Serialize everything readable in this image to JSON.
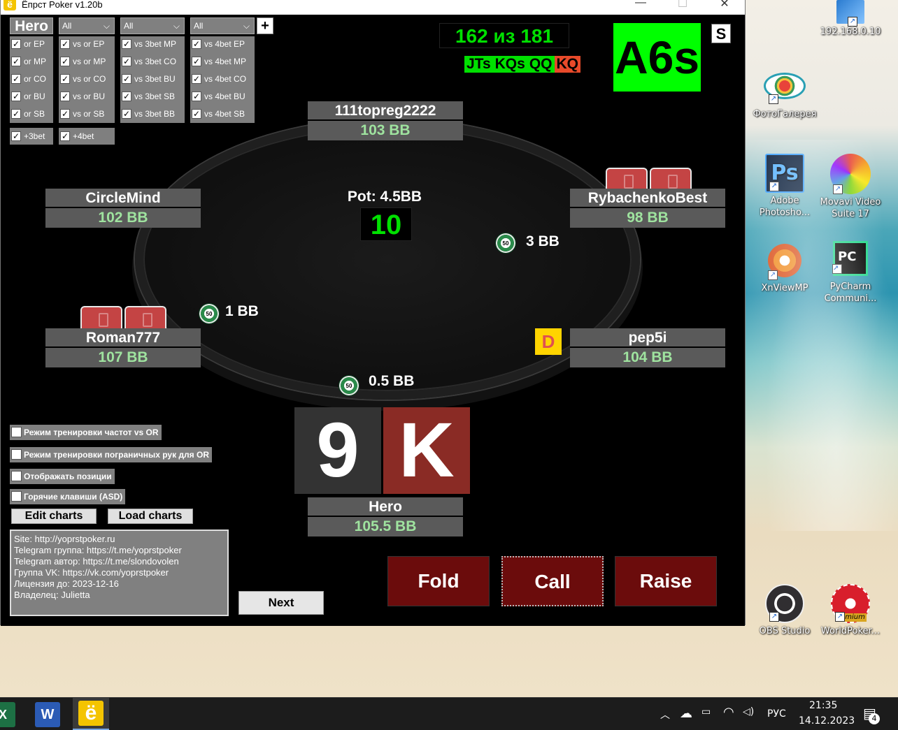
{
  "window": {
    "title": "Ёпрст Poker v1.20b",
    "app_icon": "ё"
  },
  "filters": {
    "hero_label": "Hero",
    "dropdowns": [
      "All",
      "All",
      "All"
    ],
    "plus": "+",
    "col1": [
      "or EP",
      "or MP",
      "or CO",
      "or BU",
      "or SB"
    ],
    "col2": [
      "vs or EP",
      "vs or MP",
      "vs or CO",
      "vs or BU",
      "vs or SB"
    ],
    "col3": [
      "vs 3bet MP",
      "vs 3bet CO",
      "vs 3bet BU",
      "vs 3bet SB",
      "vs 3bet BB"
    ],
    "col4": [
      "vs 4bet EP",
      "vs 4bet MP",
      "vs 4bet CO",
      "vs 4bet BU",
      "vs 4bet SB"
    ],
    "extra": [
      "+3bet",
      "+4bet"
    ]
  },
  "counter": "162 из 181",
  "hands_strip": {
    "green": [
      "JTs",
      "KQs",
      "QQ"
    ],
    "red": "KQ"
  },
  "big_hand": "A6s",
  "s_button": "S",
  "pot": {
    "label": "Pot: 4.5BB",
    "timer": "10"
  },
  "players": [
    {
      "name": "111topreg2222",
      "stack": "103 BB"
    },
    {
      "name": "CircleMind",
      "stack": "102 BB"
    },
    {
      "name": "RybachenkoBest",
      "stack": "98 BB"
    },
    {
      "name": "Roman777",
      "stack": "107 BB"
    },
    {
      "name": "pep5i",
      "stack": "104 BB"
    },
    {
      "name": "Hero",
      "stack": "105.5 BB"
    }
  ],
  "bets": {
    "rybachenko": "3 BB",
    "roman": "1 BB",
    "hero": "0.5 BB",
    "chip_label": "50"
  },
  "dealer": "D",
  "hero_cards": {
    "left": "9",
    "right": "K",
    "left_color": "#333333",
    "right_color": "#8a2b25"
  },
  "actions": {
    "fold": "Fold",
    "call": "Call",
    "raise": "Raise"
  },
  "options": [
    "Режим тренировки частот vs OR",
    "Режим тренировки пограничных рук для OR",
    "Отображать позиции",
    "Горячие клавиши (ASD)"
  ],
  "chart_buttons": {
    "edit": "Edit charts",
    "load": "Load charts"
  },
  "info_lines": [
    "Site: http://yoprstpoker.ru",
    "Telegram группа: https://t.me/yoprstpoker",
    "Telegram автор: https://t.me/slondovolen",
    "Группа VK: https://vk.com/yoprstpoker",
    "Лицензия до: 2023-12-16",
    "Владелец: Julietta"
  ],
  "next": "Next",
  "desktop_icons": [
    {
      "label": "192.168.0.10",
      "icon": "monitor-icon"
    },
    {
      "label": "ФотоГалерея",
      "icon": "photo-gallery-icon"
    },
    {
      "label": "Adobe Photosho...",
      "icon": "photoshop-icon",
      "text": "Ps"
    },
    {
      "label": "Movavi Video Suite 17",
      "icon": "movavi-icon"
    },
    {
      "label": "XnViewMP",
      "icon": "xnview-icon"
    },
    {
      "label": "PyCharm Communi...",
      "icon": "pycharm-icon",
      "text": "PC"
    },
    {
      "label": "OBS Studio",
      "icon": "obs-icon"
    },
    {
      "label": "WorldPoker...",
      "icon": "worldpoker-icon",
      "text": "remium"
    }
  ],
  "taskbar": {
    "lang": "РУС",
    "time": "21:35",
    "date": "14.12.2023",
    "notifications": "4",
    "word": "W",
    "yo": "ё"
  }
}
